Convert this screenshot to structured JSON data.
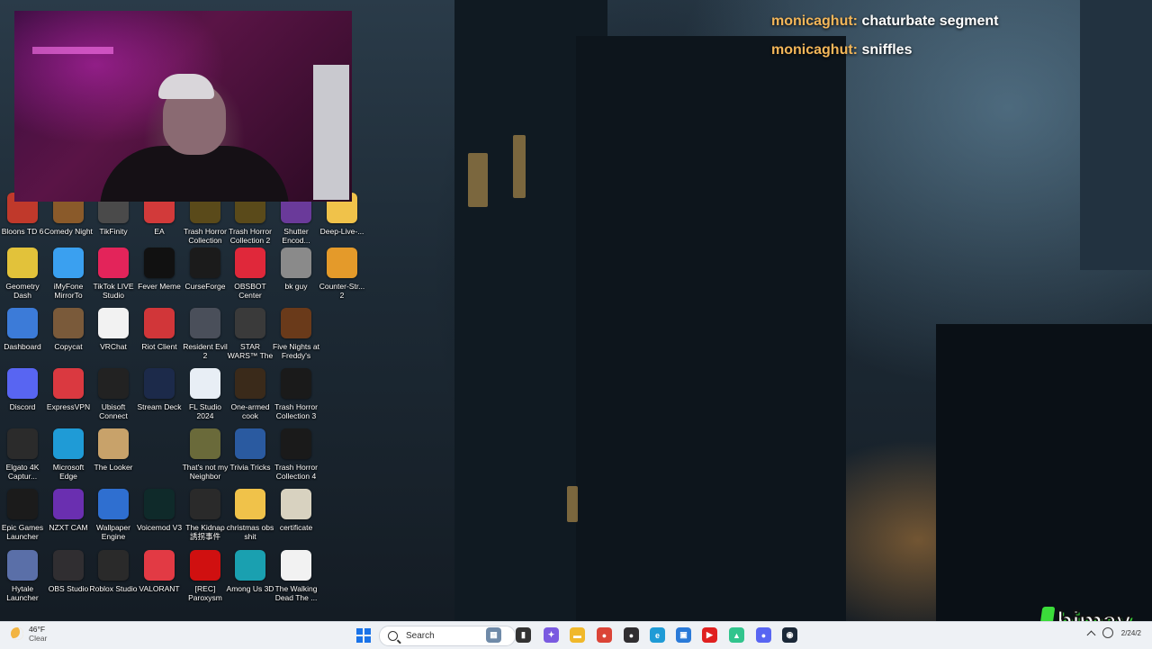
{
  "desktop": {
    "columns": [
      [
        {
          "label": "Bloons TD 6",
          "icon": "bloons-icon",
          "color": "#c0392b"
        },
        {
          "label": "Geometry Dash",
          "icon": "geometry-dash-icon",
          "color": "#e2c23a"
        },
        {
          "label": "Dashboard",
          "icon": "dashboard-icon",
          "color": "#3c7bd8"
        },
        {
          "label": "Discord",
          "icon": "discord-icon",
          "color": "#5865f2"
        },
        {
          "label": "Elgato 4K Captur...",
          "icon": "elgato-icon",
          "color": "#2b2b2b"
        },
        {
          "label": "Epic Games Launcher",
          "icon": "epic-games-icon",
          "color": "#1b1b1b"
        },
        {
          "label": "Hytale Launcher",
          "icon": "hytale-icon",
          "color": "#5a6fa8"
        }
      ],
      [
        {
          "label": "Comedy Night",
          "icon": "comedy-night-icon",
          "color": "#8a5a2a"
        },
        {
          "label": "iMyFone MirrorTo",
          "icon": "imyfone-icon",
          "color": "#3aa0f0"
        },
        {
          "label": "Copycat",
          "icon": "copycat-icon",
          "color": "#7a5a3a"
        },
        {
          "label": "ExpressVPN",
          "icon": "expressvpn-icon",
          "color": "#da3940"
        },
        {
          "label": "Microsoft Edge",
          "icon": "edge-icon",
          "color": "#1f9bd6"
        },
        {
          "label": "NZXT CAM",
          "icon": "nzxt-icon",
          "color": "#6a2fb0"
        },
        {
          "label": "OBS Studio",
          "icon": "obs-icon",
          "color": "#302e31"
        }
      ],
      [
        {
          "label": "TikFinity",
          "icon": "tikfinity-icon",
          "color": "#4a4a4a"
        },
        {
          "label": "TikTok LIVE Studio",
          "icon": "tiktok-live-icon",
          "color": "#e3245a"
        },
        {
          "label": "VRChat",
          "icon": "vrchat-icon",
          "color": "#f2f2f2"
        },
        {
          "label": "Ubisoft Connect",
          "icon": "ubisoft-icon",
          "color": "#222222"
        },
        {
          "label": "The Looker",
          "icon": "the-looker-icon",
          "color": "#c8a26a"
        },
        {
          "label": "Wallpaper Engine",
          "icon": "wallpaper-engine-icon",
          "color": "#2f6fd0"
        },
        {
          "label": "Roblox Studio",
          "icon": "roblox-studio-icon",
          "color": "#2a2a2a"
        }
      ],
      [
        {
          "label": "EA",
          "icon": "ea-icon",
          "color": "#d23a3a"
        },
        {
          "label": "Fever Meme",
          "icon": "fever-meme-icon",
          "color": "#111111"
        },
        {
          "label": "Riot Client",
          "icon": "riot-client-icon",
          "color": "#d13639"
        },
        {
          "label": "Stream Deck",
          "icon": "stream-deck-icon",
          "color": "#1c2a4a"
        },
        {
          "label": "",
          "icon": "",
          "color": ""
        },
        {
          "label": "Voicemod V3",
          "icon": "voicemod-icon",
          "color": "#0f2a2a"
        },
        {
          "label": "VALORANT",
          "icon": "valorant-icon",
          "color": "#e23a44"
        }
      ],
      [
        {
          "label": "Trash Horror Collection",
          "icon": "trash-horror-icon",
          "color": "#5a4a1a"
        },
        {
          "label": "CurseForge",
          "icon": "curseforge-icon",
          "color": "#1b1b1b"
        },
        {
          "label": "Resident Evil 2",
          "icon": "resident-evil-icon",
          "color": "#4a4f5a"
        },
        {
          "label": "FL Studio 2024",
          "icon": "fl-studio-icon",
          "color": "#e8eef5"
        },
        {
          "label": "That's not my Neighbor",
          "icon": "neighbor-icon",
          "color": "#6a6a3a"
        },
        {
          "label": "The Kidnap 誘拐事件",
          "icon": "kidnap-icon",
          "color": "#2a2a2a"
        },
        {
          "label": "[REC] Paroxysm",
          "icon": "rec-paroxysm-icon",
          "color": "#d01010"
        }
      ],
      [
        {
          "label": "Trash Horror Collection 2",
          "icon": "trash-horror-2-icon",
          "color": "#5a4a1a"
        },
        {
          "label": "OBSBOT Center",
          "icon": "obsbot-icon",
          "color": "#e0283a"
        },
        {
          "label": "STAR WARS™ The Force ...",
          "icon": "star-wars-icon",
          "color": "#3a3a3a"
        },
        {
          "label": "One-armed cook",
          "icon": "one-armed-cook-icon",
          "color": "#3a2a1a"
        },
        {
          "label": "Trivia Tricks",
          "icon": "trivia-tricks-icon",
          "color": "#2a5aa0"
        },
        {
          "label": "christmas obs shit",
          "icon": "folder-icon",
          "color": "#f0c24a"
        },
        {
          "label": "Among Us 3D",
          "icon": "among-us-icon",
          "color": "#1aa0b0"
        }
      ],
      [
        {
          "label": "Shutter Encod...",
          "icon": "shutter-encoder-icon",
          "color": "#6a3a9a"
        },
        {
          "label": "bk guy",
          "icon": "bk-guy-icon",
          "color": "#8a8a8a"
        },
        {
          "label": "Five Nights at Freddy's",
          "icon": "fnaf-icon",
          "color": "#6a3a1a"
        },
        {
          "label": "Trash Horror Collection 3",
          "icon": "trash-horror-3-icon",
          "color": "#1a1a1a"
        },
        {
          "label": "Trash Horror Collection 4",
          "icon": "trash-horror-4-icon",
          "color": "#1a1a1a"
        },
        {
          "label": "certificate",
          "icon": "certificate-icon",
          "color": "#d8d2c0"
        },
        {
          "label": "The Walking Dead The ...",
          "icon": "walking-dead-icon",
          "color": "#f2f2f2"
        }
      ],
      [
        {
          "label": "Deep-Live-...",
          "icon": "folder-icon",
          "color": "#f0c24a"
        },
        {
          "label": "Counter-Str... 2",
          "icon": "counter-strike-icon",
          "color": "#e49a2a"
        }
      ]
    ]
  },
  "chat": [
    {
      "user": "monicaghut:",
      "message": "chaturbate segment"
    },
    {
      "user": "monicaghut:",
      "message": "sniffles"
    }
  ],
  "logo": {
    "text": "himay"
  },
  "taskbar": {
    "weather": {
      "temp": "46°F",
      "condition": "Clear"
    },
    "search_placeholder": "Search",
    "apps": [
      {
        "name": "widgets-icon",
        "glyph": "▦",
        "color": "#6f8aa8"
      },
      {
        "name": "task-view-icon",
        "glyph": "▮",
        "color": "#333333"
      },
      {
        "name": "copilot-icon",
        "glyph": "✦",
        "color": "#7a5ae0"
      },
      {
        "name": "file-explorer-icon",
        "glyph": "▬",
        "color": "#f0b82a"
      },
      {
        "name": "chrome-icon",
        "glyph": "●",
        "color": "#db4437"
      },
      {
        "name": "obs-taskbar-icon",
        "glyph": "●",
        "color": "#302e31"
      },
      {
        "name": "edge-taskbar-icon",
        "glyph": "e",
        "color": "#1f9bd6"
      },
      {
        "name": "store-icon",
        "glyph": "▣",
        "color": "#2a7ad8"
      },
      {
        "name": "youtube-icon",
        "glyph": "▶",
        "color": "#e02020"
      },
      {
        "name": "streamlabs-icon",
        "glyph": "▲",
        "color": "#31c48d"
      },
      {
        "name": "discord-taskbar-icon",
        "glyph": "●",
        "color": "#5865f2"
      },
      {
        "name": "steam-icon",
        "glyph": "◉",
        "color": "#1b2838"
      }
    ],
    "clock": "2/24/2"
  }
}
